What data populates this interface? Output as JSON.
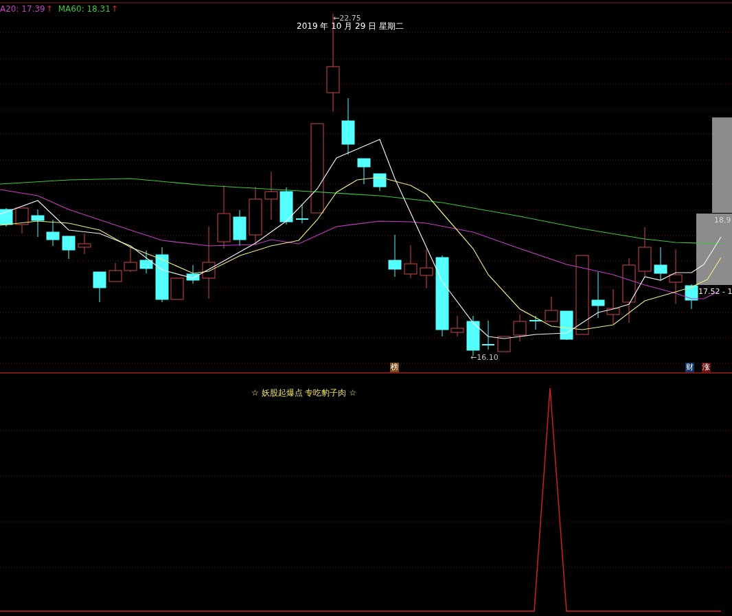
{
  "legend": [
    {
      "label": "A20: 17.39",
      "color": "#c83cc8",
      "arrow": "↑"
    },
    {
      "label": "MA60: 18.31",
      "color": "#3cc83c",
      "arrow": "↑"
    }
  ],
  "price_pane": {
    "date_label": "2019 年 10 月 29 日 星期二",
    "high_marker": {
      "arrow": "←",
      "value": "22.75"
    },
    "low_marker": {
      "arrow": "←",
      "value": "16.10"
    },
    "price_labels": [
      "18.9",
      "17.52 - 1"
    ],
    "badges": [
      {
        "text": "榜",
        "kind": "rank"
      },
      {
        "text": "财",
        "kind": "finance"
      },
      {
        "text": "涨",
        "kind": "rise"
      }
    ]
  },
  "indicator_pane": {
    "title": "☆ 妖股起爆点 专吃豹子肉 ☆"
  }
}
